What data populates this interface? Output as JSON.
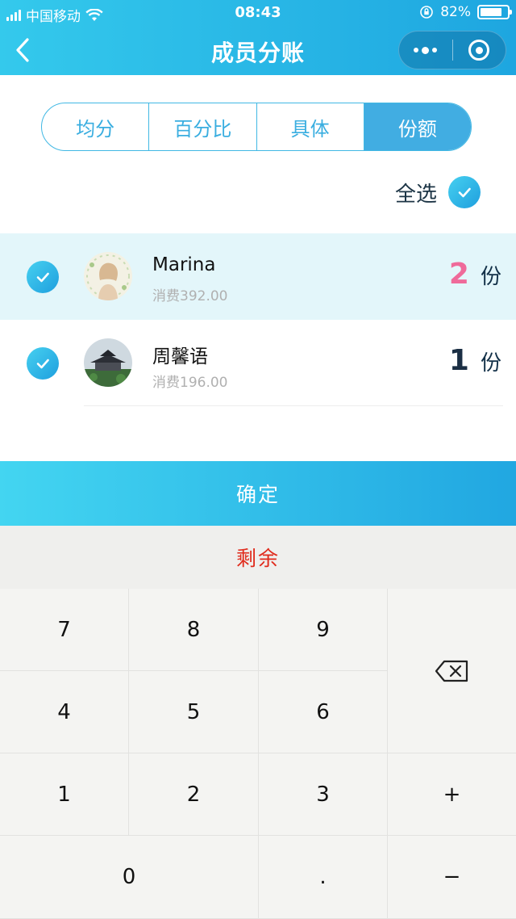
{
  "status_bar": {
    "carrier": "中国移动",
    "time": "08:43",
    "battery": "82%",
    "battery_level": 0.82
  },
  "nav": {
    "title": "成员分账",
    "more_icon": "more-dots-icon",
    "close_icon": "target-circle-icon"
  },
  "modes": [
    {
      "label": "均分",
      "active": false
    },
    {
      "label": "百分比",
      "active": false
    },
    {
      "label": "具体",
      "active": false
    },
    {
      "label": "份额",
      "active": true
    }
  ],
  "select_all": {
    "label": "全选",
    "checked": true
  },
  "members": [
    {
      "name": "Marina",
      "spend": "消费392.00",
      "shares": "2",
      "unit": "份",
      "checked": true,
      "highlight": true,
      "share_color": "#ef6a9a"
    },
    {
      "name": "周馨语",
      "spend": "消费196.00",
      "shares": "1",
      "unit": "份",
      "checked": true,
      "highlight": false,
      "share_color": "#1b2f44"
    }
  ],
  "confirm_label": "确定",
  "remaining_label": "剩余",
  "keypad": {
    "k7": "7",
    "k8": "8",
    "k9": "9",
    "k4": "4",
    "k5": "5",
    "k6": "6",
    "k1": "1",
    "k2": "2",
    "k3": "3",
    "plus": "+",
    "k0": "0",
    "dot": ".",
    "minus": "−",
    "delete_icon": "backspace-icon"
  },
  "colors": {
    "brand": "#2bb5e6",
    "accent_pink": "#ef6a9a",
    "remaining_red": "#e02b1c"
  }
}
